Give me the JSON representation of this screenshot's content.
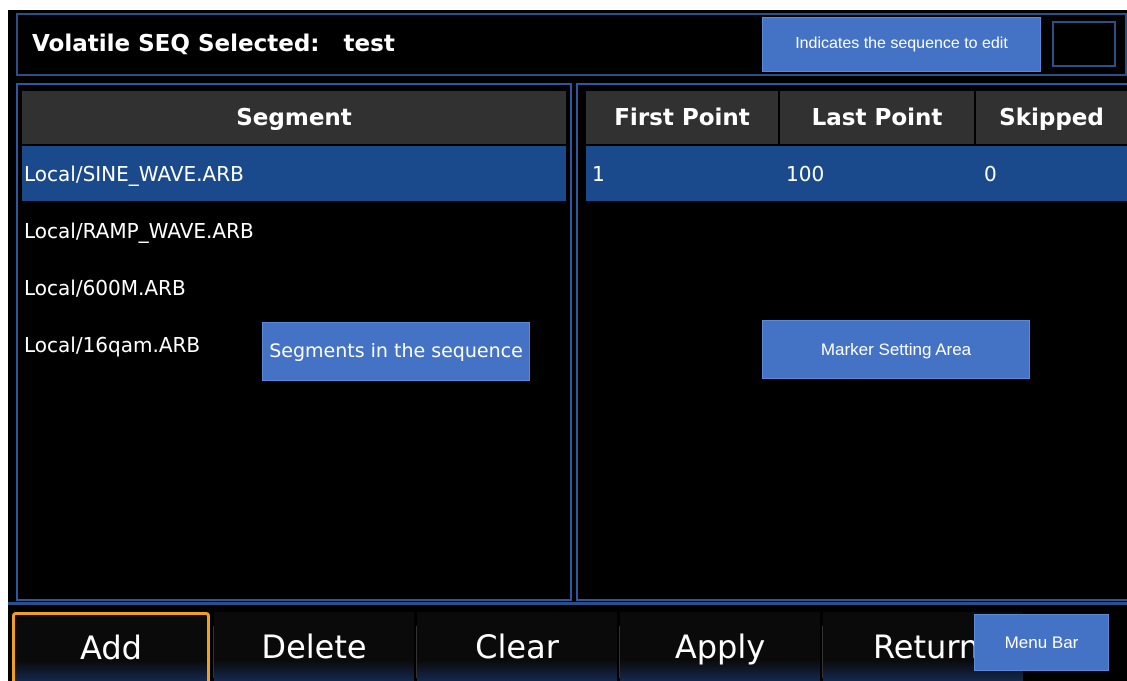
{
  "title": {
    "label": "Volatile SEQ Selected:",
    "sequence_name": "test"
  },
  "callouts": {
    "sequence_to_edit": "Indicates the sequence to edit",
    "segments": "Segments in the sequence",
    "marker_area": "Marker Setting Area",
    "menu_bar": "Menu Bar"
  },
  "segment_table": {
    "header": "Segment",
    "rows": [
      "Local/SINE_WAVE.ARB",
      "Local/RAMP_WAVE.ARB",
      "Local/600M.ARB",
      "Local/16qam.ARB"
    ],
    "selected_index": 0
  },
  "marker_table": {
    "headers": [
      "First Point",
      "Last Point",
      "Skipped"
    ],
    "rows": [
      {
        "first": "1",
        "last": "100",
        "skipped": "0"
      }
    ]
  },
  "menu": {
    "items": [
      "Add",
      "Delete",
      "Clear",
      "Apply",
      "Return"
    ],
    "active_index": 0
  },
  "colors": {
    "accent_blue": "#4472c4",
    "selected_row": "#1a4a8c",
    "active_outline": "#f0a020",
    "border_blue": "#2d57a0"
  }
}
